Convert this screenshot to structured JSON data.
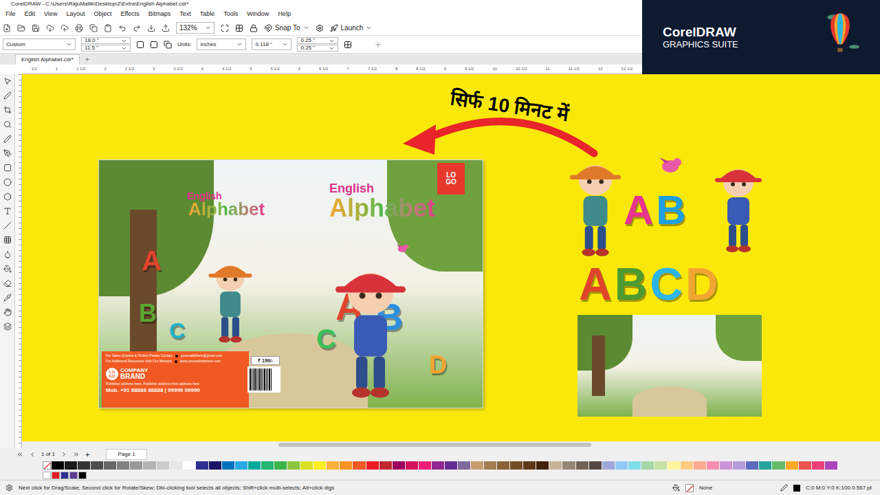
{
  "window": {
    "title": "CorelDRAW - C:\\Users\\RajuMallik\\Desktop\\Z\\Extra\\English Alphabet.cdr*"
  },
  "brand": {
    "name": "CorelDRAW",
    "suite": "GRAPHICS SUITE"
  },
  "menu": [
    "File",
    "Edit",
    "View",
    "Layout",
    "Object",
    "Effects",
    "Bitmaps",
    "Text",
    "Table",
    "Tools",
    "Window",
    "Help"
  ],
  "toolbar": {
    "zoom": "132%",
    "snap": "Snap To",
    "launch": "Launch"
  },
  "property_bar": {
    "preset": "Custom",
    "width": "18.0 \"",
    "height": "11.5 \"",
    "units_label": "Units:",
    "units": "inches",
    "nudge": "0.118 \"",
    "dup_x": "0.25 \"",
    "dup_y": "0.25 \""
  },
  "doc_tabs": [
    {
      "label": "English Alphabet.cdr*",
      "selected": true
    }
  ],
  "new_tab": "+",
  "ruler": [
    "1/2",
    "1",
    "1 1/2",
    "2",
    "2 1/2",
    "3",
    "3 1/2",
    "4",
    "4 1/2",
    "5",
    "5 1/2",
    "6",
    "6 1/2",
    "7",
    "7 1/2",
    "8",
    "8 1/2",
    "9",
    "9 1/2",
    "10",
    "10 1/2",
    "11",
    "11 1/2",
    "12",
    "12 1/2"
  ],
  "canvas": {
    "caption": "सिर्फ 10 मिनट में",
    "cover": {
      "back": {
        "title_top": "English",
        "title_main": "Alphabet",
        "letters": [
          {
            "char": "A",
            "color": "#e0452b"
          },
          {
            "char": "B",
            "color": "#5aa832"
          },
          {
            "char": "C",
            "color": "#1fb3c9"
          }
        ],
        "contact_lines": [
          {
            "label": "For Sales Queries & Orders Please Contact",
            "value": "yourmailidhere@gmail.com"
          },
          {
            "label": "For Additional Resources Visit Our Website",
            "value": "www.yourwebsitehere.com"
          }
        ],
        "logo": [
          "LO",
          "GO"
        ],
        "company": "COMPANY",
        "brand": "BRAND",
        "address": "Publisher address here, Publisher address here address here",
        "phone": "Mob. +91 88888 88888 | 99999 99999",
        "price": "₹ 199/-"
      },
      "front": {
        "title_top": "English",
        "title_main": "Alphabet",
        "logo": [
          "LO",
          "GO"
        ],
        "letters": [
          {
            "char": "C",
            "color": "#3cc15a"
          },
          {
            "char": "A",
            "color": "#e0452b"
          },
          {
            "char": "B",
            "color": "#2b8fe0"
          },
          {
            "char": "D",
            "color": "#f3a531"
          }
        ]
      }
    },
    "assets": {
      "small_letters": [
        {
          "char": "A",
          "color": "#e8348f"
        },
        {
          "char": "B",
          "color": "#1e9fe0"
        }
      ],
      "big_letters": [
        {
          "char": "A",
          "color": "#e0452b"
        },
        {
          "char": "B",
          "color": "#4d9a30"
        },
        {
          "char": "C",
          "color": "#2cb6e6"
        },
        {
          "char": "D",
          "color": "#f3a531"
        }
      ]
    }
  },
  "page_nav": {
    "count": "1 of 1",
    "add": "+",
    "page": "Page 1"
  },
  "palette": [
    "#000000",
    "#1a1a1a",
    "#333333",
    "#4d4d4d",
    "#666666",
    "#808080",
    "#999999",
    "#b3b3b3",
    "#cccccc",
    "#e6e6e6",
    "#ffffff",
    "#2e3192",
    "#1b1464",
    "#0071bc",
    "#29abe2",
    "#00a99d",
    "#22b573",
    "#39b54a",
    "#8cc63f",
    "#d9e021",
    "#fcee21",
    "#fbb03b",
    "#f7931e",
    "#f15a24",
    "#ed1c24",
    "#c1272d",
    "#9e005d",
    "#d4145a",
    "#ed1e79",
    "#93278f",
    "#662d91",
    "#7f6a9f",
    "#c69c6d",
    "#a67c52",
    "#8c6239",
    "#754c24",
    "#603813",
    "#42210b",
    "#c7b299",
    "#998675",
    "#736357",
    "#534741",
    "#9fa8da",
    "#90caf9",
    "#80deea",
    "#a5d6a7",
    "#c5e1a5",
    "#fff59d",
    "#ffcc80",
    "#ffab91",
    "#f48fb1",
    "#ce93d8",
    "#b39ddb",
    "#5c6bc0",
    "#26a69a",
    "#66bb6a",
    "#ffa726",
    "#ef5350",
    "#ec407a",
    "#ab47bc"
  ],
  "palette_recent": [
    "#ffffff",
    "#e31e24",
    "#2e3192",
    "#5b3a9a",
    "#000000"
  ],
  "status_bar": {
    "hint": "Next click for Drag/Scale; Second click for Rotate/Skew; Dbl-clicking tool selects all objects; Shift+click multi-selects; Alt+click digs",
    "fill": "None",
    "outline": "C:0 M:0 Y:0 K:100 0.567 pt",
    "outline_color": "#000000"
  }
}
